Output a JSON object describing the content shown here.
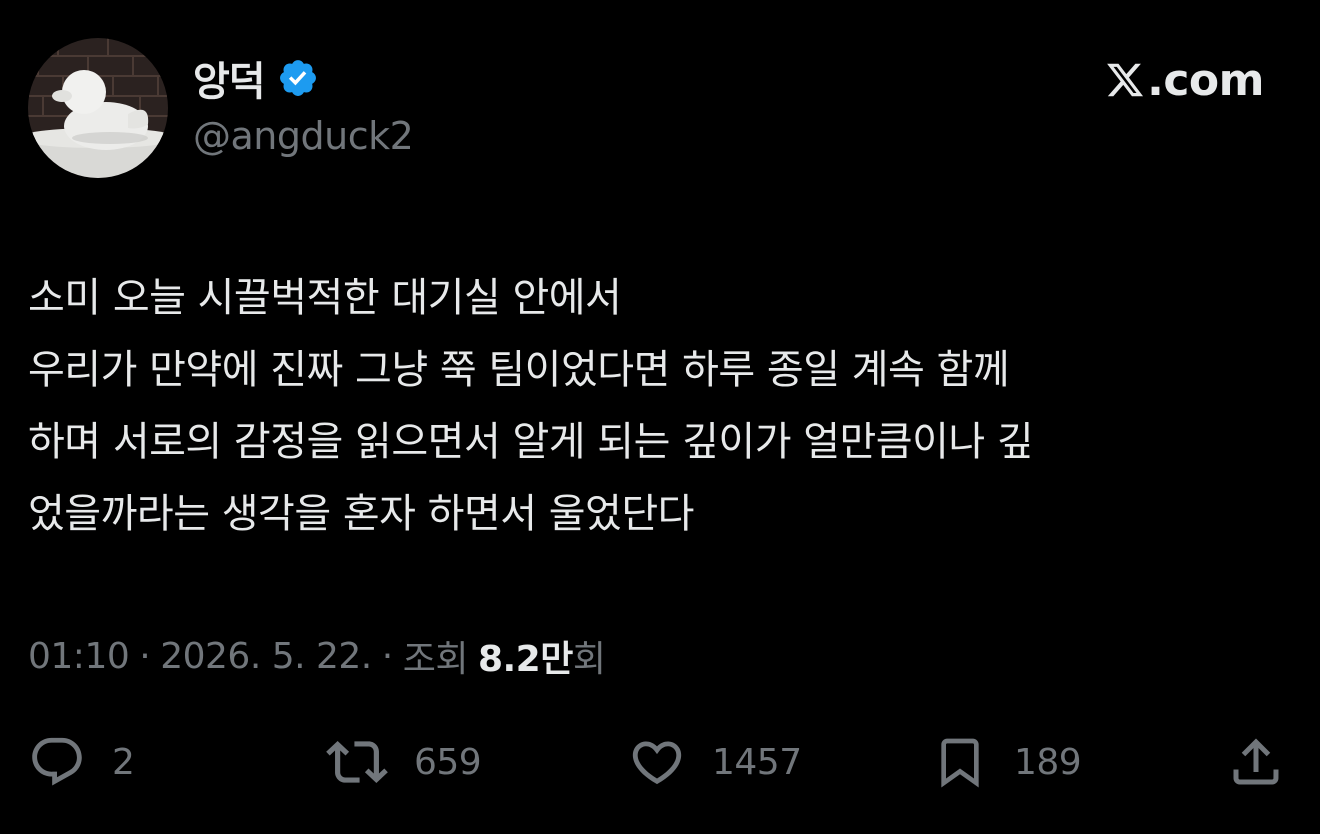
{
  "author": {
    "display_name": "앙덕",
    "handle": "@angduck2",
    "verified": true,
    "verified_color": "#1d9bf0",
    "avatar_icon": "snow-duck-avatar"
  },
  "brand": {
    "label": ".com",
    "icon": "x-logo-icon"
  },
  "tweet": {
    "lines": [
      "소미 오늘 시끌벅적한 대기실 안에서",
      "우리가 만약에 진짜 그냥 쭉 팀이었다면 하루 종일 계속 함께",
      "하며 서로의 감정을 읽으면서 알게 되는 깊이가 얼만큼이나 깊",
      "었을까라는 생각을 혼자 하면서 울었단다"
    ]
  },
  "meta": {
    "time": "01:10",
    "separator": "·",
    "date": "2026. 5. 22.",
    "views_prefix": "조회",
    "views_count": "8.2만",
    "views_suffix": "회"
  },
  "actions": {
    "replies": "2",
    "retweets": "659",
    "likes": "1457",
    "bookmarks": "189"
  },
  "colors": {
    "background": "#000000",
    "text_primary": "#e7e9ea",
    "text_secondary": "#71767b",
    "accent": "#1d9bf0"
  }
}
